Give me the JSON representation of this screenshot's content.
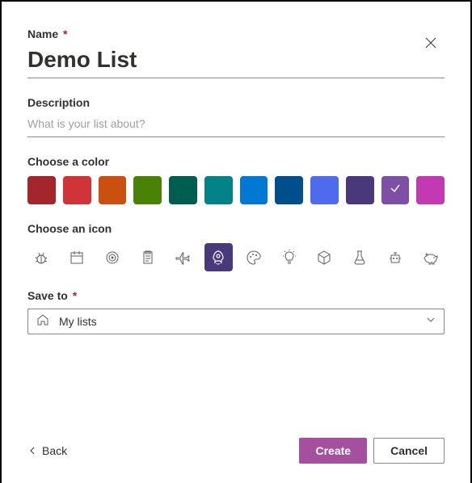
{
  "name": {
    "label": "Name",
    "value": "Demo List"
  },
  "description": {
    "label": "Description",
    "placeholder": "What is your list about?",
    "value": ""
  },
  "color_section": {
    "label": "Choose a color",
    "selected_index": 10,
    "colors": [
      "#a4262c",
      "#d13438",
      "#ca5010",
      "#498205",
      "#005e50",
      "#038387",
      "#0078d4",
      "#004e8c",
      "#4f6bed",
      "#49397a",
      "#7e4fa6",
      "#c239b3"
    ]
  },
  "icon_section": {
    "label": "Choose an icon",
    "selected_index": 5,
    "selected_bg": "#49397a",
    "icons": [
      "bug",
      "calendar",
      "target",
      "clipboard",
      "airplane",
      "rocket",
      "palette",
      "lightbulb",
      "cube",
      "flask",
      "robot",
      "piggybank"
    ]
  },
  "save_to": {
    "label": "Save to",
    "value": "My lists"
  },
  "footer": {
    "back": "Back",
    "create": "Create",
    "cancel": "Cancel"
  }
}
